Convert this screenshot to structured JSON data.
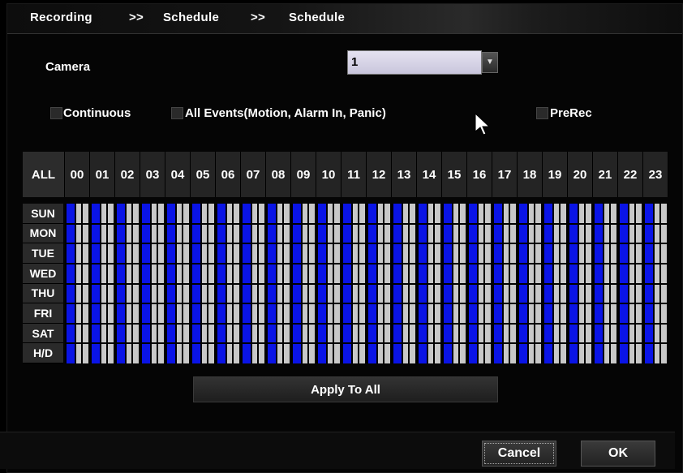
{
  "breadcrumb": {
    "items": [
      "Recording",
      "Schedule",
      "Schedule"
    ],
    "separator": ">>"
  },
  "camera": {
    "label": "Camera",
    "selected_value": "1"
  },
  "options": {
    "continuous": {
      "label": "Continuous",
      "checked": false
    },
    "all_events": {
      "label": "All Events(Motion, Alarm In, Panic)",
      "checked": false
    },
    "prerec": {
      "label": "PreRec",
      "checked": false
    }
  },
  "schedule": {
    "all_label": "ALL",
    "hours": [
      "00",
      "01",
      "02",
      "03",
      "04",
      "05",
      "06",
      "07",
      "08",
      "09",
      "10",
      "11",
      "12",
      "13",
      "14",
      "15",
      "16",
      "17",
      "18",
      "19",
      "20",
      "21",
      "22",
      "23"
    ],
    "days": [
      "SUN",
      "MON",
      "TUE",
      "WED",
      "THU",
      "FRI",
      "SAT",
      "H/D"
    ],
    "colors": {
      "inactive": "#c8c8c8",
      "active": "#0a14e6",
      "header": "#242424"
    }
  },
  "buttons": {
    "apply_to_all": "Apply To All",
    "cancel": "Cancel",
    "ok": "OK"
  },
  "icons": {
    "cursor": "mouse-pointer-icon",
    "dropdown": "chevron-down-icon"
  }
}
